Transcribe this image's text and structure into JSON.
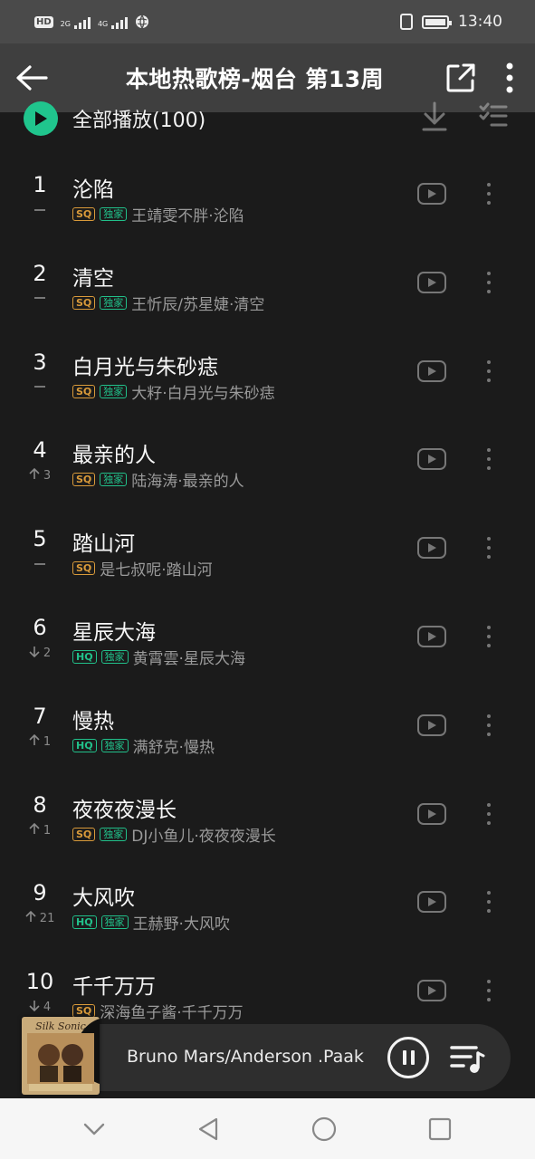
{
  "status_bar": {
    "left_badge": "HD",
    "net1": "2G",
    "net2": "4G",
    "time": "13:40"
  },
  "header": {
    "title": "本地热歌榜-烟台 第13周"
  },
  "play_all": {
    "label": "全部播放(100)"
  },
  "songs": [
    {
      "rank": "1",
      "title": "沦陷",
      "trend": "",
      "trend_dir": "none",
      "quality": "SQ",
      "exclusive": "独家",
      "meta": "王靖雯不胖·沦陷"
    },
    {
      "rank": "2",
      "title": "清空",
      "trend": "",
      "trend_dir": "none",
      "quality": "SQ",
      "exclusive": "独家",
      "meta": "王忻辰/苏星婕·清空"
    },
    {
      "rank": "3",
      "title": "白月光与朱砂痣",
      "trend": "",
      "trend_dir": "none",
      "quality": "SQ",
      "exclusive": "独家",
      "meta": "大籽·白月光与朱砂痣"
    },
    {
      "rank": "4",
      "title": "最亲的人",
      "trend": "3",
      "trend_dir": "up",
      "quality": "SQ",
      "exclusive": "独家",
      "meta": "陆海涛·最亲的人"
    },
    {
      "rank": "5",
      "title": "踏山河",
      "trend": "",
      "trend_dir": "none",
      "quality": "SQ",
      "exclusive": "",
      "meta": "是七叔呢·踏山河"
    },
    {
      "rank": "6",
      "title": "星辰大海",
      "trend": "2",
      "trend_dir": "down",
      "quality": "HQ",
      "exclusive": "独家",
      "meta": "黄霄雲·星辰大海"
    },
    {
      "rank": "7",
      "title": "慢热",
      "trend": "1",
      "trend_dir": "up",
      "quality": "HQ",
      "exclusive": "独家",
      "meta": "满舒克·慢热"
    },
    {
      "rank": "8",
      "title": "夜夜夜漫长",
      "trend": "1",
      "trend_dir": "up",
      "quality": "SQ",
      "exclusive": "独家",
      "meta": "DJ小鱼儿·夜夜夜漫长"
    },
    {
      "rank": "9",
      "title": "大风吹",
      "trend": "21",
      "trend_dir": "up",
      "quality": "HQ",
      "exclusive": "独家",
      "meta": "王赫野·大风吹"
    },
    {
      "rank": "10",
      "title": "千千万万",
      "trend": "4",
      "trend_dir": "down",
      "quality": "SQ",
      "exclusive": "",
      "meta": "深海鱼子酱·千千万万"
    }
  ],
  "now_playing": {
    "title": "Bruno Mars/Anderson .Paak",
    "album_text": "Silk Sonic"
  },
  "colors": {
    "accent": "#20c58d",
    "sq_tag": "#d99a3a",
    "background": "#1b1b1b"
  },
  "icons": [
    "back-arrow-icon",
    "share-icon",
    "more-vertical-icon",
    "play-circle-icon",
    "download-icon",
    "multi-select-icon",
    "mv-play-icon",
    "pause-icon",
    "playlist-icon",
    "nav-down-icon",
    "nav-back-icon",
    "nav-home-icon",
    "nav-recents-icon"
  ]
}
